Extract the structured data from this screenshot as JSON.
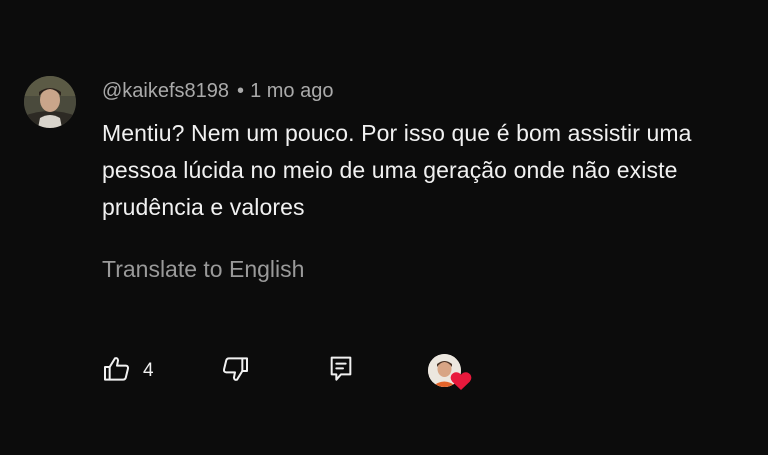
{
  "comment": {
    "author": "@kaikefs8198",
    "separator": "•",
    "time": "1 mo ago",
    "text": "Mentiu? Nem um pouco. Por isso que é bom assistir uma pessoa lúcida no meio de uma geração onde não existe prudência e valores",
    "translate_label": "Translate to English"
  },
  "actions": {
    "like_count": "4",
    "like_icon": "thumbs-up-icon",
    "dislike_icon": "thumbs-down-icon",
    "reply_icon": "reply-comment-icon",
    "heart_icon": "creator-heart-icon"
  },
  "colors": {
    "background": "#0c0c0c",
    "primary_text": "#f1f1f1",
    "secondary_text": "#aaaaaa",
    "heart": "#e8193c"
  }
}
